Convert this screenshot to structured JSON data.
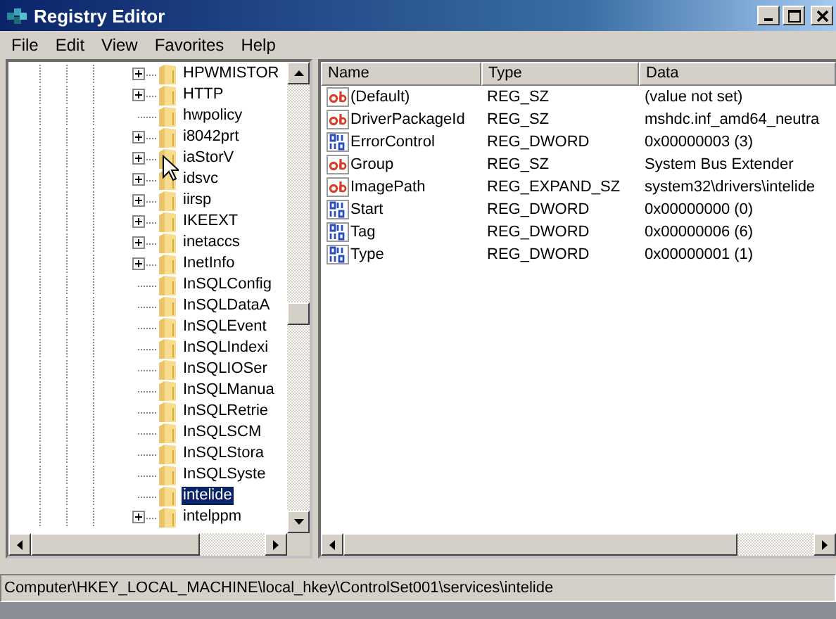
{
  "window": {
    "title": "Registry Editor"
  },
  "menu": [
    "File",
    "Edit",
    "View",
    "Favorites",
    "Help"
  ],
  "tree": [
    {
      "label": "HPWMISTOR",
      "has_children": true,
      "selected": false
    },
    {
      "label": "HTTP",
      "has_children": true,
      "selected": false
    },
    {
      "label": "hwpolicy",
      "has_children": false,
      "selected": false
    },
    {
      "label": "i8042prt",
      "has_children": true,
      "selected": false
    },
    {
      "label": "iaStorV",
      "has_children": true,
      "selected": false
    },
    {
      "label": "idsvc",
      "has_children": true,
      "selected": false
    },
    {
      "label": "iirsp",
      "has_children": true,
      "selected": false
    },
    {
      "label": "IKEEXT",
      "has_children": true,
      "selected": false
    },
    {
      "label": "inetaccs",
      "has_children": true,
      "selected": false
    },
    {
      "label": "InetInfo",
      "has_children": true,
      "selected": false
    },
    {
      "label": "InSQLConfig",
      "has_children": false,
      "selected": false
    },
    {
      "label": "InSQLDataA",
      "has_children": false,
      "selected": false
    },
    {
      "label": "InSQLEvent",
      "has_children": false,
      "selected": false
    },
    {
      "label": "InSQLIndexi",
      "has_children": false,
      "selected": false
    },
    {
      "label": "InSQLIOSer",
      "has_children": false,
      "selected": false
    },
    {
      "label": "InSQLManua",
      "has_children": false,
      "selected": false
    },
    {
      "label": "InSQLRetrie",
      "has_children": false,
      "selected": false
    },
    {
      "label": "InSQLSCM",
      "has_children": false,
      "selected": false
    },
    {
      "label": "InSQLStora",
      "has_children": false,
      "selected": false
    },
    {
      "label": "InSQLSyste",
      "has_children": false,
      "selected": false
    },
    {
      "label": "intelide",
      "has_children": false,
      "selected": true
    },
    {
      "label": "intelppm",
      "has_children": true,
      "selected": false
    }
  ],
  "table": {
    "columns": [
      "Name",
      "Type",
      "Data"
    ],
    "rows": [
      {
        "kind": "string",
        "name": "(Default)",
        "type": "REG_SZ",
        "data": "(value not set)"
      },
      {
        "kind": "string",
        "name": "DriverPackageId",
        "type": "REG_SZ",
        "data": "mshdc.inf_amd64_neutra"
      },
      {
        "kind": "binary",
        "name": "ErrorControl",
        "type": "REG_DWORD",
        "data": "0x00000003 (3)"
      },
      {
        "kind": "string",
        "name": "Group",
        "type": "REG_SZ",
        "data": "System Bus Extender"
      },
      {
        "kind": "string",
        "name": "ImagePath",
        "type": "REG_EXPAND_SZ",
        "data": "system32\\drivers\\intelide"
      },
      {
        "kind": "binary",
        "name": "Start",
        "type": "REG_DWORD",
        "data": "0x00000000 (0)"
      },
      {
        "kind": "binary",
        "name": "Tag",
        "type": "REG_DWORD",
        "data": "0x00000006 (6)"
      },
      {
        "kind": "binary",
        "name": "Type",
        "type": "REG_DWORD",
        "data": "0x00000001 (1)"
      }
    ]
  },
  "status_bar": "Computer\\HKEY_LOCAL_MACHINE\\local_hkey\\ControlSet001\\services\\intelide"
}
